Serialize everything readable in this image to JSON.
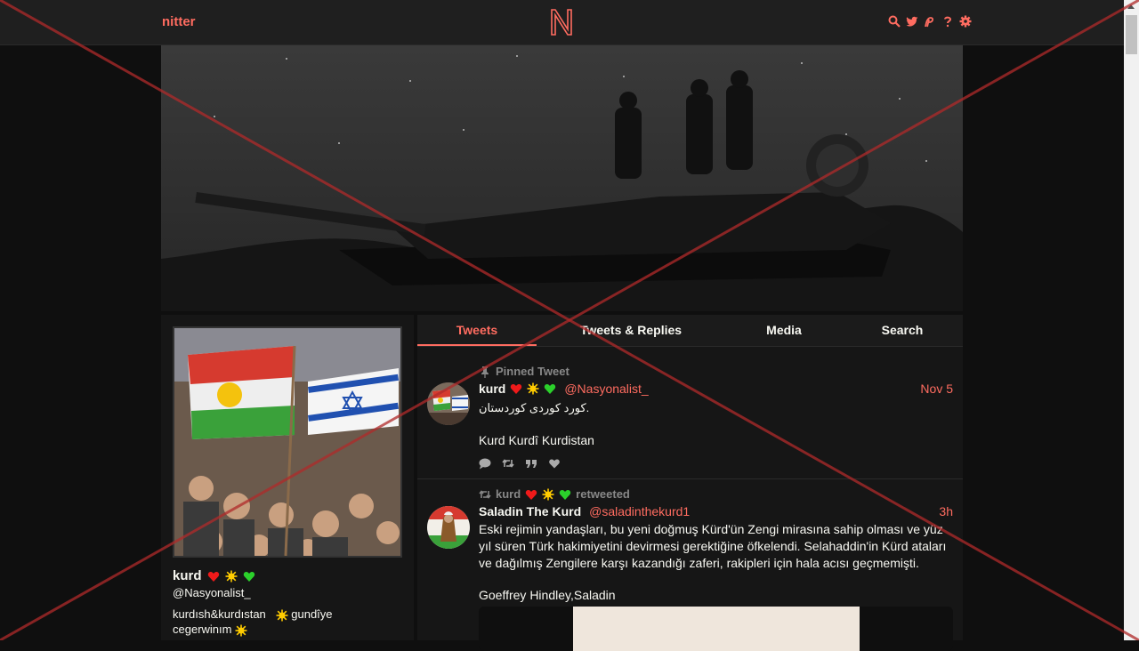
{
  "navbar": {
    "brand": "nitter",
    "logo_letter": "N",
    "icons": [
      "search-icon",
      "twitter-icon",
      "rss-icon",
      "help-icon",
      "settings-icon"
    ]
  },
  "profile": {
    "name": "kurd",
    "handle": "@Nasyonalist_",
    "bio_line1": "kurdısh&kurdıstan",
    "bio_line2": "gundîye",
    "bio_line3": "cegerwinım",
    "name_emojis": [
      "red-heart",
      "sun",
      "green-heart"
    ]
  },
  "tabs": [
    {
      "label": "Tweets",
      "active": true
    },
    {
      "label": "Tweets & Replies",
      "active": false
    },
    {
      "label": "Media",
      "active": false
    },
    {
      "label": "Search",
      "active": false
    }
  ],
  "tweets": [
    {
      "pinned_label": "Pinned Tweet",
      "fullname": "kurd",
      "username": "@Nasyonalist_",
      "date": "Nov 5",
      "content_line1": "کورد کوردی کوردستان.",
      "content_line2": "Kurd Kurdî Kurdistan"
    },
    {
      "retweeter": "kurd",
      "retweet_label": "retweeted",
      "fullname": "Saladin The Kurd",
      "username": "@saladinthekurd1",
      "date": "3h",
      "content_line1": "Eski rejimin yandaşları, bu yeni doğmuş Kürd'ün Zengi mirasına sahip olması ve yüz",
      "content_line2": "yıl süren Türk hakimiyetini devirmesi gerektiğine öfkelendi. Selahaddin'in Kürd ataları",
      "content_line3": "ve dağılmış Zengilere karşı kazandığı zaferi, rakipleri için hala acısı geçmemişti.",
      "content_line4": "Goeffrey Hindley,Saladin"
    }
  ],
  "colors": {
    "accent": "#ff6c60",
    "background": "#0f0f0f",
    "panel": "#161616",
    "overlay_x": "#b02a2a"
  }
}
